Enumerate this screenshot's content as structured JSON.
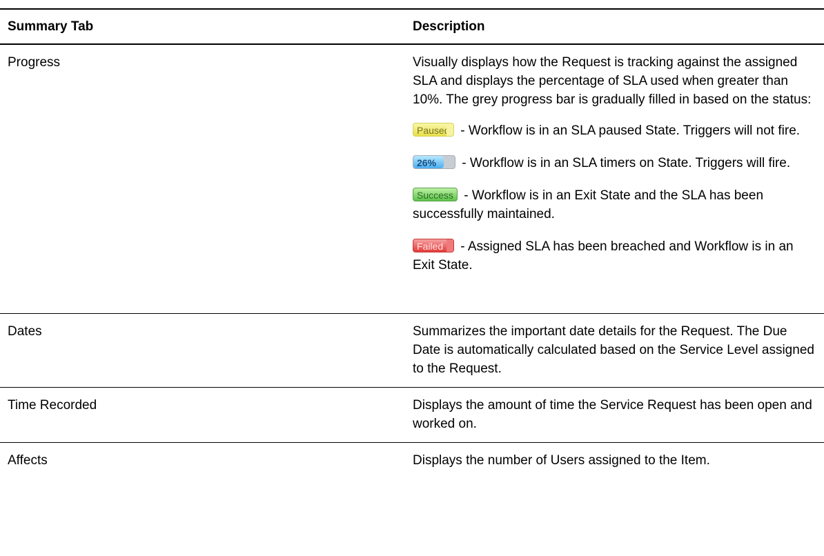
{
  "table": {
    "headers": {
      "col1": "Summary Tab",
      "col2": "Description"
    },
    "progress": {
      "label": "Progress",
      "intro": "Visually displays how the Request is tracking against the assigned SLA and displays the percentage of SLA used when greater than 10%. The grey progress bar is gradually filled in based on the status:",
      "statuses": [
        {
          "badge": "Paused",
          "text": "- Workflow is in an SLA paused State. Triggers will not fire."
        },
        {
          "badge": "26%",
          "fill_fraction": 0.26,
          "text": "- Workflow is in an SLA timers on State. Triggers will fire."
        },
        {
          "badge": "Success",
          "text": "- Workflow is in an Exit State and the SLA has been successfully maintained."
        },
        {
          "badge": "Failed",
          "text": "- Assigned SLA has been breached and Workflow is in an Exit State."
        }
      ]
    },
    "dates": {
      "label": "Dates",
      "description": "Summarizes the important date details for the Request. The Due Date is automatically calculated based on the Service Level assigned to the Request."
    },
    "time_recorded": {
      "label": "Time Recorded",
      "description": "Displays the amount of time the Service Request has been open and worked on."
    },
    "affects": {
      "label": "Affects",
      "description": "Displays the number of Users assigned to the Item."
    }
  },
  "colors": {
    "paused": "#e8e04a",
    "timer": "#4aaef0",
    "success": "#5ec44a",
    "failed": "#e53a3a"
  }
}
